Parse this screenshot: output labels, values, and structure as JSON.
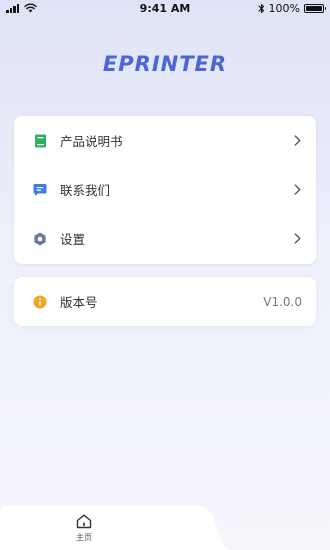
{
  "status_bar": {
    "time": "9:41 AM",
    "battery_text": "100%",
    "battery_level": 1.0
  },
  "app": {
    "logo_text": "EPRINTER"
  },
  "menu": {
    "items": [
      {
        "label": "产品说明书",
        "icon": "book-icon",
        "icon_color": "#2fb05c"
      },
      {
        "label": "联系我们",
        "icon": "chat-icon",
        "icon_color": "#3c7ee8"
      },
      {
        "label": "设置",
        "icon": "gear-icon",
        "icon_color": "#6b7a99"
      }
    ]
  },
  "version": {
    "label": "版本号",
    "value": "V1.0.0",
    "icon": "info-icon",
    "icon_color": "#f5a623"
  },
  "tab_bar": {
    "home_label": "主页"
  },
  "colors": {
    "accent": "#4a66d8",
    "background_top": "#dfe3f7",
    "card": "#ffffff"
  }
}
